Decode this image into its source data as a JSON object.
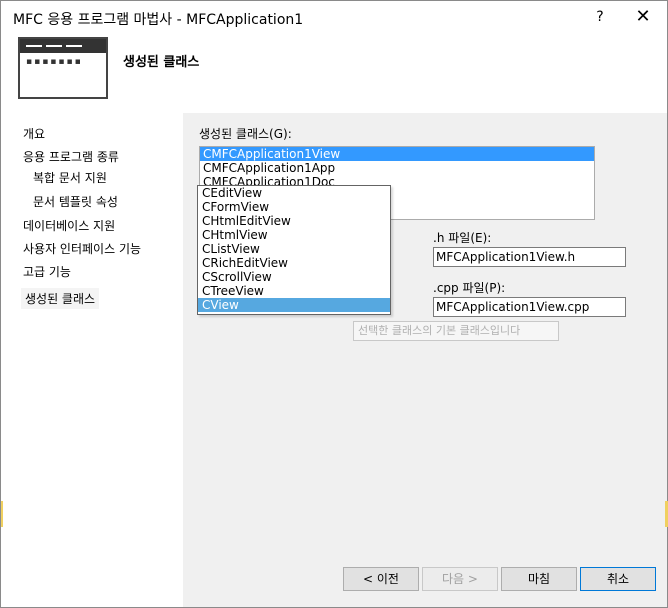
{
  "window": {
    "title": "MFC 응용 프로그램 마법사 - MFCApplication1",
    "help_label": "?",
    "close_label": "✕"
  },
  "header": {
    "title": "생성된 클래스",
    "icon": "wizard-window-icon"
  },
  "nav": {
    "items": [
      {
        "label": "개요"
      },
      {
        "label": "응용 프로그램 종류"
      },
      {
        "label": "복합 문서 지원"
      },
      {
        "label": "문서 템플릿 속성"
      },
      {
        "label": "데이터베이스 지원"
      },
      {
        "label": "사용자 인터페이스 기능"
      },
      {
        "label": "고급 기능"
      },
      {
        "label": "생성된 클래스"
      }
    ],
    "selected": "생성된 클래스"
  },
  "main": {
    "generated_classes_label": "생성된 클래스(G):",
    "class_list": [
      "CMFCApplication1View",
      "CMFCApplication1App",
      "CMFCApplication1Doc"
    ],
    "selected_class": "CMFCApplication1View",
    "base_class_options": [
      "CEditView",
      "CFormView",
      "CHtmlEditView",
      "CHtmlView",
      "CListView",
      "CRichEditView",
      "CScrollView",
      "CTreeView",
      "CView"
    ],
    "selected_base_class": "CView",
    "h_file_label": ".h 파일(E):",
    "h_file_value": "MFCApplication1View.h",
    "cpp_file_label": ".cpp 파일(P):",
    "cpp_file_value": "MFCApplication1View.cpp",
    "tooltip": "선택한 클래스의 기본 클래스입니다"
  },
  "buttons": {
    "prev": "< 이전",
    "next": "다음 >",
    "finish": "마침",
    "cancel": "취소"
  }
}
